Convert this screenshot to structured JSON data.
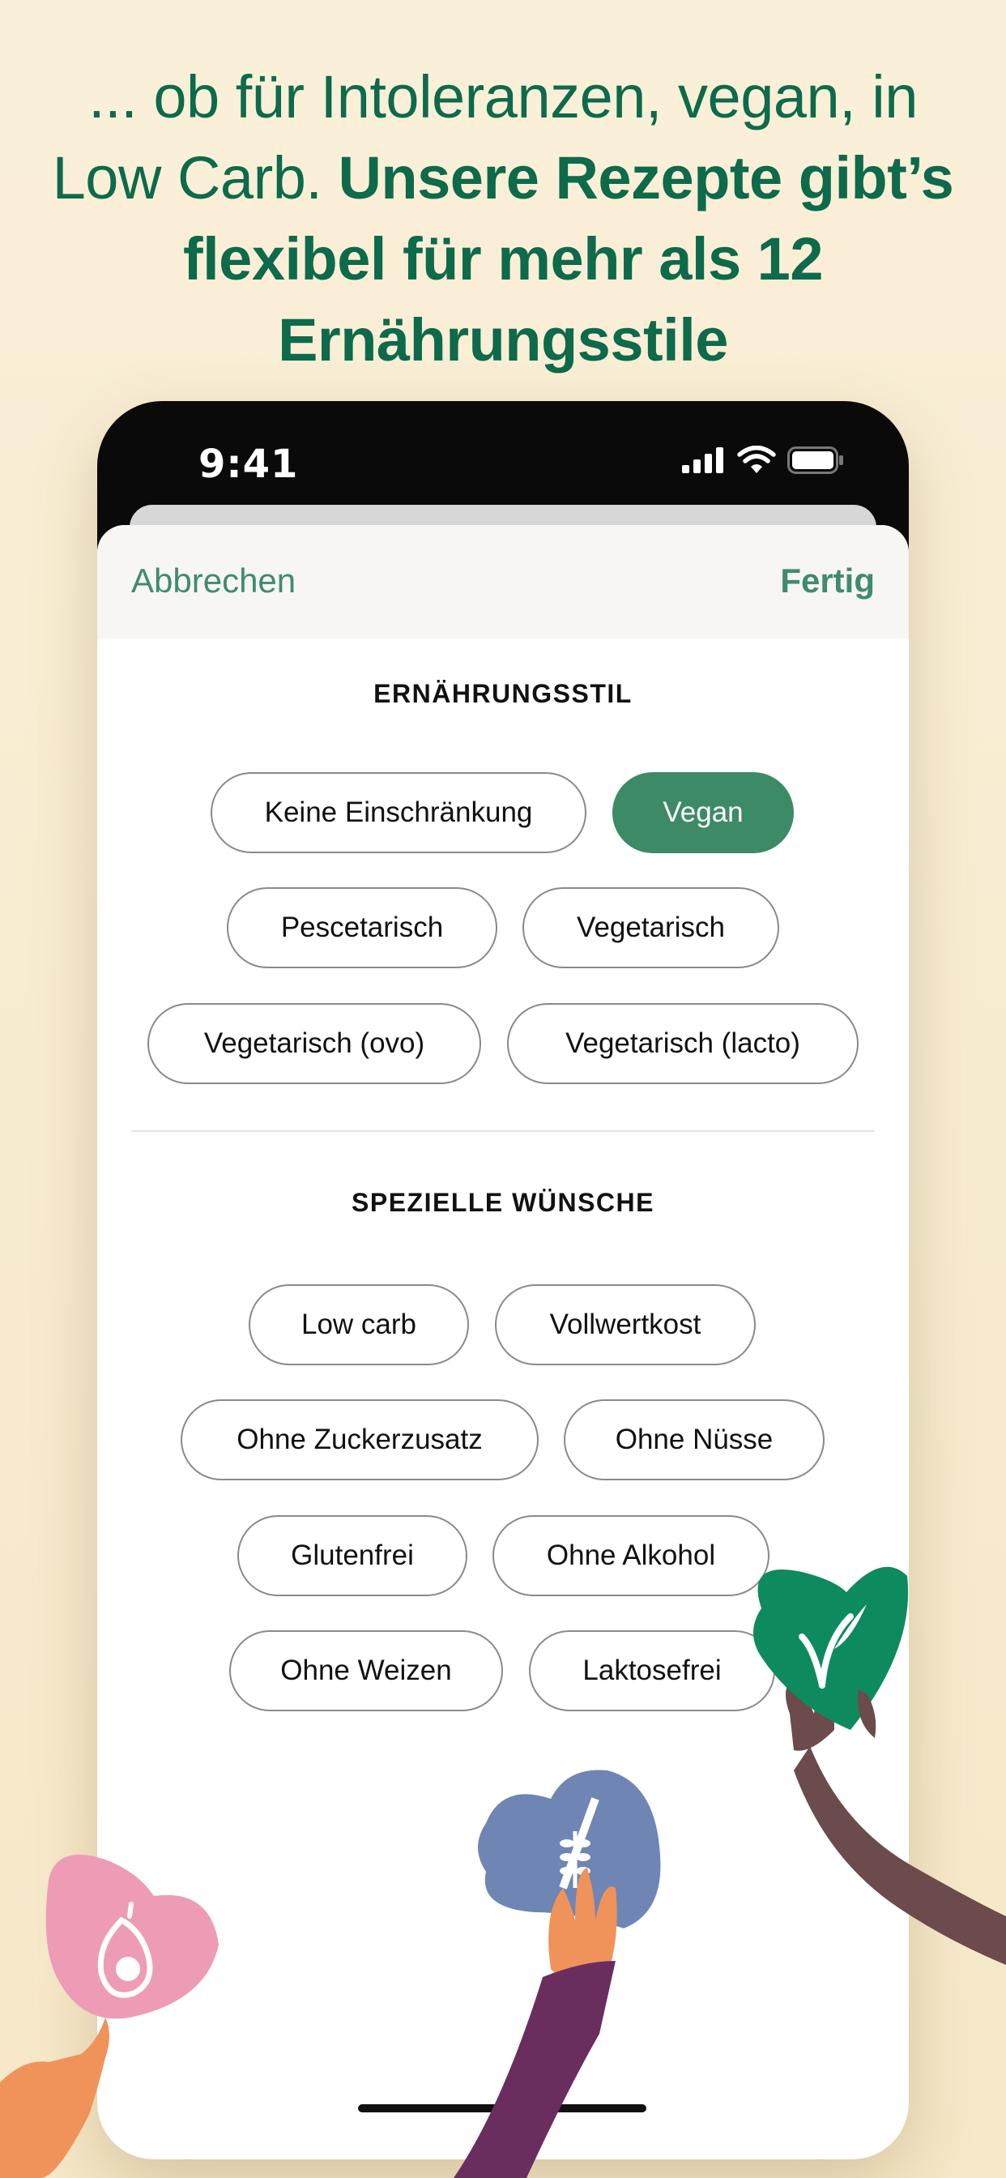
{
  "headline": {
    "regular": "... ob für Intoleranzen, vegan, in Low Carb.",
    "bold": "Unsere Rezepte gibt’s flexibel für mehr als 12 Ernährungsstile"
  },
  "status_bar": {
    "time": "9:41"
  },
  "nav": {
    "cancel_label": "Abbrechen",
    "done_label": "Fertig"
  },
  "section_diet": {
    "title": "ERNÄHRUNGSSTIL",
    "chips": [
      {
        "label": "Keine Einschränkung",
        "selected": false
      },
      {
        "label": "Vegan",
        "selected": true
      },
      {
        "label": "Pescetarisch",
        "selected": false
      },
      {
        "label": "Vegetarisch",
        "selected": false
      },
      {
        "label": "Vegetarisch (ovo)",
        "selected": false
      },
      {
        "label": "Vegetarisch (lacto)",
        "selected": false
      }
    ]
  },
  "section_wishes": {
    "title": "SPEZIELLE WÜNSCHE",
    "chips": [
      {
        "label": "Low carb",
        "selected": false
      },
      {
        "label": "Vollwertkost",
        "selected": false
      },
      {
        "label": "Ohne Zuckerzusatz",
        "selected": false
      },
      {
        "label": "Ohne Nüsse",
        "selected": false
      },
      {
        "label": "Glutenfrei",
        "selected": false
      },
      {
        "label": "Ohne Alkohol",
        "selected": false
      },
      {
        "label": "Ohne Weizen",
        "selected": false
      },
      {
        "label": "Laktosefrei",
        "selected": false
      }
    ]
  },
  "colors": {
    "headline": "#0d6a4b",
    "accent": "#3d8a67",
    "background": "#f8edd2",
    "heart_green": "#0e8a5f",
    "heart_blue": "#6f85b4",
    "heart_pink": "#ee9cb5"
  },
  "illustrations": [
    "vegan-leaf-heart-icon",
    "wheat-free-heart-icon",
    "avocado-heart-icon"
  ]
}
